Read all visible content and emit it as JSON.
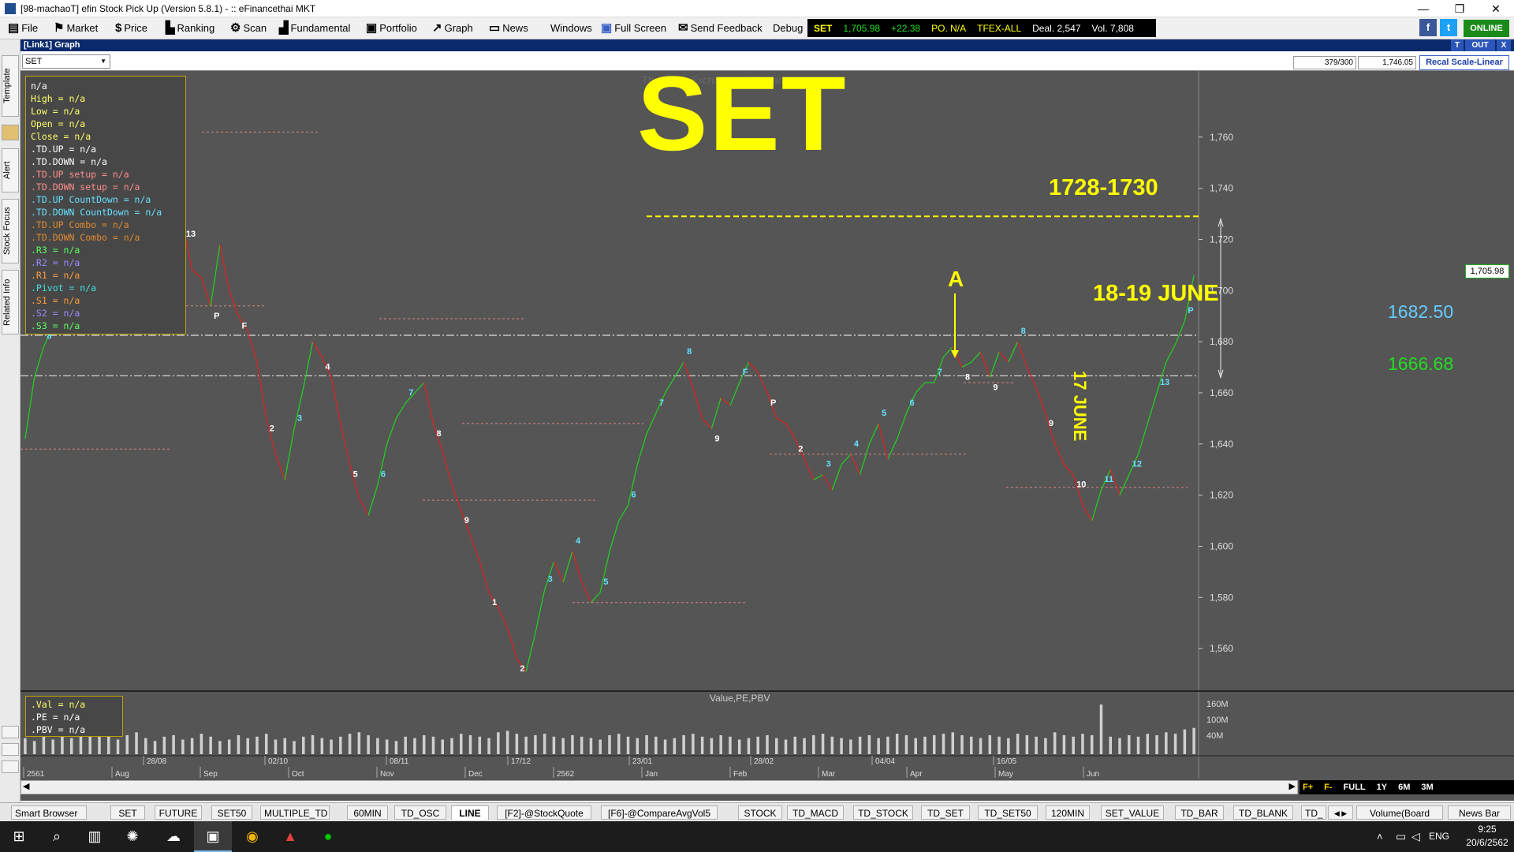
{
  "window": {
    "title": "[98-machaoT] efin Stock Pick Up (Version 5.8.1) - :: eFinancethai MKT",
    "controls": [
      "—",
      "❐",
      "✕"
    ]
  },
  "menu": [
    {
      "label": "File",
      "icon": "file-icon"
    },
    {
      "label": "Market",
      "icon": "market-icon"
    },
    {
      "label": "Price",
      "icon": "dollar-icon"
    },
    {
      "label": "Ranking",
      "icon": "ranking-icon"
    },
    {
      "label": "Scan",
      "icon": "scan-icon"
    },
    {
      "label": "Fundamental",
      "icon": "bar-chart-icon"
    },
    {
      "label": "Portfolio",
      "icon": "portfolio-icon"
    },
    {
      "label": "Graph",
      "icon": "graph-icon"
    },
    {
      "label": "News",
      "icon": "news-icon"
    },
    {
      "label": "Windows",
      "icon": ""
    },
    {
      "label": "Full Screen",
      "icon": "fullscreen-icon"
    },
    {
      "label": "Send Feedback",
      "icon": "feedback-icon"
    },
    {
      "label": "Debug",
      "icon": ""
    }
  ],
  "ticker": {
    "index": "SET",
    "price": "1,705.98",
    "change": "+22.38",
    "po": "PO. N/A",
    "tfex": "TFEX-ALL",
    "deal": "Deal. 2,547",
    "vol": "Vol. 7,808"
  },
  "status": {
    "online": "ONLINE"
  },
  "graph_window": {
    "header": "[Link1] Graph",
    "buttons": [
      "T",
      "OUT",
      "X"
    ],
    "symbol": "SET",
    "bar_count": "379/300",
    "price_box": "1,746.05",
    "recal": "Recal Scale-Linear",
    "big_title": "SET",
    "faint_title": "The Stock Exchange of Thailand",
    "lower_pane_title": "Value,PE,PBV",
    "current_price_tag": "1,705.98"
  },
  "sidebar_tabs": [
    "Template",
    "Alert",
    "Stock Focus",
    "Related Info"
  ],
  "info_legend": [
    {
      "text": "n/a",
      "color": "#ffffff"
    },
    {
      "text": "High  = n/a",
      "color": "#ffff66"
    },
    {
      "text": "Low  = n/a",
      "color": "#ffff66"
    },
    {
      "text": "Open  = n/a",
      "color": "#ffff66"
    },
    {
      "text": "Close  = n/a",
      "color": "#ffff66"
    },
    {
      "text": ".TD.UP  = n/a",
      "color": "#ffffff"
    },
    {
      "text": ".TD.DOWN  = n/a",
      "color": "#ffffff"
    },
    {
      "text": ".TD.UP setup  = n/a",
      "color": "#ff8c8c"
    },
    {
      "text": ".TD.DOWN setup  = n/a",
      "color": "#ff8c8c"
    },
    {
      "text": ".TD.UP CountDown  = n/a",
      "color": "#66e0ff"
    },
    {
      "text": ".TD.DOWN CountDown  = n/a",
      "color": "#66e0ff"
    },
    {
      "text": ".TD.UP Combo  = n/a",
      "color": "#e08a30"
    },
    {
      "text": ".TD.DOWN Combo  = n/a",
      "color": "#e08a30"
    },
    {
      "text": ".R3  = n/a",
      "color": "#5cff5c"
    },
    {
      "text": ".R2  = n/a",
      "color": "#9a8cff"
    },
    {
      "text": ".R1  = n/a",
      "color": "#ff9a3c"
    },
    {
      "text": ".Pivot  = n/a",
      "color": "#40e0e0"
    },
    {
      "text": ".S1  = n/a",
      "color": "#ff9a3c"
    },
    {
      "text": ".S2  = n/a",
      "color": "#9a8cff"
    },
    {
      "text": ".S3  = n/a",
      "color": "#5cff5c"
    }
  ],
  "value_legend": [
    {
      "text": ".Val  = n/a",
      "color": "#ffff66"
    },
    {
      "text": ".PE  = n/a",
      "color": "#ffffff"
    },
    {
      "text": ".PBV  = n/a",
      "color": "#ffffff"
    }
  ],
  "annotations": {
    "resistance_label": "1728-1730",
    "date_label": "18-19 JUNE",
    "point_a": "A",
    "level_high": "1682.50",
    "level_low": "1666.68",
    "vertical_label": "17 JUNE"
  },
  "colors": {
    "chart_bg": "#555555",
    "up": "#22cc22",
    "down": "#dd2222",
    "annotation_yellow": "#ffff00",
    "level_high": "#66ccff",
    "level_low": "#22dd22",
    "td_count": "#66e0ff"
  },
  "chart_data": {
    "type": "line",
    "title": "SET",
    "y_ticks": [
      1560,
      1580,
      1600,
      1620,
      1640,
      1660,
      1680,
      1700,
      1720,
      1740,
      1760
    ],
    "y_tick_labels": [
      "1,560",
      "1,580",
      "1,600",
      "1,620",
      "1,640",
      "1,660",
      "1,680",
      "1,700",
      "1,720",
      "1,740",
      "1,760"
    ],
    "ylim": [
      1544,
      1784
    ],
    "volume_ticks": [
      "160M",
      "100M",
      "40M"
    ],
    "x_top_labels": [
      "28/08",
      "02/10",
      "08/11",
      "17/12",
      "23/01",
      "28/02",
      "04/04",
      "16/05"
    ],
    "x_bottom_labels": [
      "2561",
      "Aug",
      "Sep",
      "Oct",
      "Nov",
      "Dec",
      "2562",
      "Jan",
      "Feb",
      "Mar",
      "Apr",
      "May",
      "Jun"
    ],
    "close": [
      1642,
      1666,
      1678,
      1686,
      1692,
      1700,
      1710,
      1725,
      1742,
      1752,
      1757,
      1748,
      1745,
      1751,
      1760,
      1744,
      1732,
      1726,
      1708,
      1705,
      1694,
      1718,
      1700,
      1690,
      1684,
      1672,
      1650,
      1636,
      1626,
      1646,
      1662,
      1680,
      1674,
      1666,
      1648,
      1632,
      1619,
      1612,
      1624,
      1640,
      1650,
      1656,
      1660,
      1664,
      1648,
      1637,
      1624,
      1614,
      1604,
      1594,
      1582,
      1576,
      1568,
      1556,
      1551,
      1566,
      1583,
      1594,
      1586,
      1598,
      1586,
      1578,
      1582,
      1598,
      1610,
      1616,
      1632,
      1644,
      1652,
      1660,
      1666,
      1672,
      1662,
      1650,
      1646,
      1658,
      1655,
      1664,
      1672,
      1668,
      1660,
      1650,
      1648,
      1642,
      1634,
      1626,
      1628,
      1622,
      1632,
      1636,
      1628,
      1640,
      1648,
      1634,
      1642,
      1652,
      1660,
      1664,
      1664,
      1674,
      1678,
      1670,
      1672,
      1676,
      1666,
      1676,
      1672,
      1680,
      1670,
      1662,
      1652,
      1640,
      1632,
      1628,
      1616,
      1610,
      1622,
      1630,
      1620,
      1628,
      1636,
      1648,
      1660,
      1672,
      1679,
      1688,
      1706
    ],
    "levels": [
      {
        "label": "1728-1730",
        "value": 1729
      },
      {
        "label": "1682.50",
        "value": 1682.5
      },
      {
        "label": "1666.68",
        "value": 1666.68
      }
    ],
    "volume": [
      22,
      18,
      24,
      20,
      26,
      22,
      30,
      34,
      28,
      24,
      20,
      26,
      30,
      22,
      18,
      24,
      26,
      20,
      22,
      28,
      24,
      18,
      20,
      26,
      22,
      24,
      28,
      20,
      22,
      18,
      24,
      26,
      22,
      20,
      24,
      28,
      30,
      26,
      22,
      20,
      18,
      24,
      22,
      26,
      24,
      20,
      22,
      28,
      26,
      24,
      22,
      30,
      32,
      28,
      24,
      26,
      28,
      24,
      22,
      26,
      24,
      22,
      20,
      26,
      28,
      24,
      22,
      26,
      24,
      20,
      22,
      26,
      28,
      24,
      22,
      26,
      24,
      20,
      22,
      24,
      26,
      22,
      20,
      24,
      22,
      26,
      28,
      24,
      22,
      20,
      24,
      26,
      22,
      24,
      28,
      26,
      22,
      24,
      26,
      28,
      30,
      26,
      24,
      22,
      26,
      24,
      22,
      28,
      26,
      24,
      22,
      30,
      26,
      24,
      28,
      26,
      68,
      24,
      22,
      26,
      24,
      28,
      26,
      30,
      28,
      34,
      36
    ]
  },
  "scroll_ranges": [
    "F+",
    "F-",
    "FULL",
    "1Y",
    "6M",
    "3M"
  ],
  "bottom_tabs": [
    "Smart Browser",
    "SET",
    "FUTURE",
    "SET50",
    "MULTIPLE_TD",
    "60MIN",
    "TD_OSC",
    "LINE",
    "[F2]-@StockQuote",
    "[F6]-@CompareAvgVol5",
    "STOCK",
    "TD_MACD",
    "TD_STOCK",
    "TD_SET",
    "TD_SET50",
    "120MIN",
    "SET_VALUE",
    "TD_BAR",
    "TD_BLANK",
    "TD_",
    "Volume(Board Lot)",
    "News Bar"
  ],
  "taskbar": {
    "lang": "ENG",
    "time": "9:25",
    "date": "20/6/2562"
  }
}
